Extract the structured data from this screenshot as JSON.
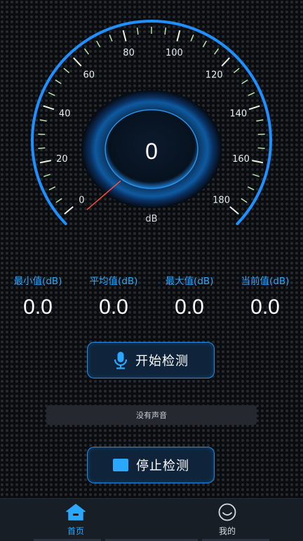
{
  "gauge": {
    "value": "0",
    "unit": "dB",
    "tick_labels": [
      "0",
      "20",
      "40",
      "60",
      "80",
      "100",
      "120",
      "140",
      "160",
      "180"
    ],
    "accent_color": "#1e90ff",
    "needle_color": "#ff4040"
  },
  "stats": [
    {
      "label": "最小值(dB)",
      "value": "0.0"
    },
    {
      "label": "平均值(dB)",
      "value": "0.0"
    },
    {
      "label": "最大值(dB)",
      "value": "0.0"
    },
    {
      "label": "当前值(dB)",
      "value": "0.0"
    }
  ],
  "start_button": {
    "label": "开始检测",
    "icon": "microphone-icon"
  },
  "status": {
    "text": "没有声音"
  },
  "stop_button": {
    "label": "停止检测",
    "icon": "stop-square-icon"
  },
  "nav": {
    "items": [
      {
        "label": "首页",
        "icon": "home-icon",
        "active": true
      },
      {
        "label": "我的",
        "icon": "smiley-icon",
        "active": false
      }
    ],
    "active_color": "#2aa7ff",
    "inactive_color": "#c9cdd2"
  }
}
